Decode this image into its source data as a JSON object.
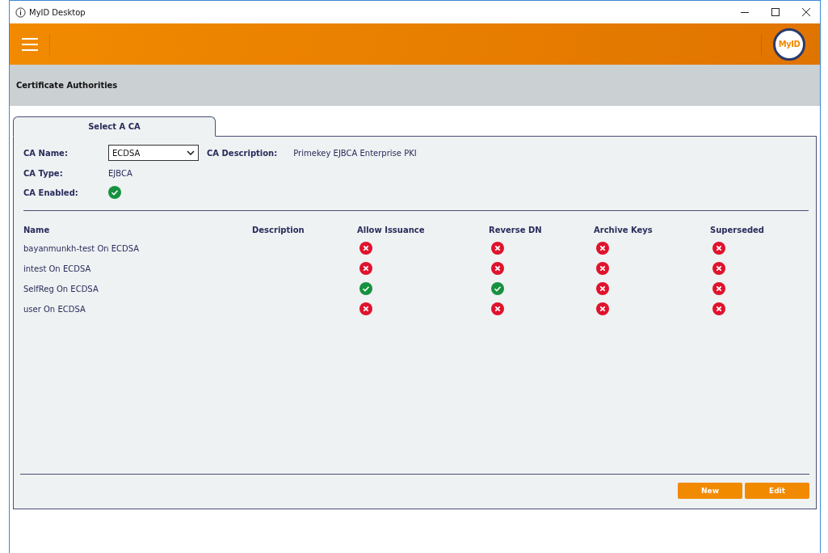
{
  "window": {
    "title": "MyID Desktop"
  },
  "header": {
    "logo": "MyID"
  },
  "page_title": "Certificate Authorities",
  "tabs": [
    {
      "label": "Select A CA",
      "selected": true
    }
  ],
  "ca": {
    "name_label": "CA Name:",
    "name_value": "ECDSA",
    "description_label": "CA Description:",
    "description_value": "Primekey EJBCA Enterprise PKI",
    "type_label": "CA Type:",
    "type_value": "EJBCA",
    "enabled_label": "CA Enabled:",
    "enabled": true
  },
  "table": {
    "columns": [
      "Name",
      "Description",
      "Allow Issuance",
      "Reverse DN",
      "Archive Keys",
      "Superseded"
    ],
    "rows": [
      {
        "name": "bayanmunkh-test On ECDSA",
        "allow_issuance": false,
        "reverse_dn": false,
        "archive_keys": false,
        "superseded": false
      },
      {
        "name": "intest On ECDSA",
        "allow_issuance": false,
        "reverse_dn": false,
        "archive_keys": false,
        "superseded": false
      },
      {
        "name": "SelfReg On ECDSA",
        "allow_issuance": true,
        "reverse_dn": true,
        "archive_keys": false,
        "superseded": false
      },
      {
        "name": "user On ECDSA",
        "allow_issuance": false,
        "reverse_dn": false,
        "archive_keys": false,
        "superseded": false
      }
    ]
  },
  "buttons": [
    "New",
    "Edit"
  ]
}
